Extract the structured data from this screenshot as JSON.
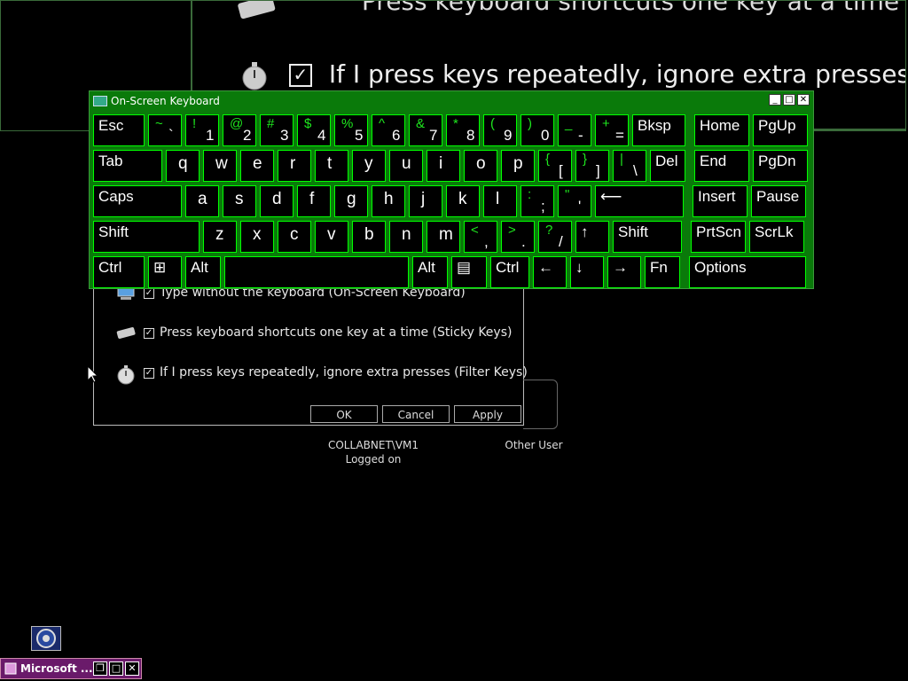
{
  "magnifier": {
    "line_top": "Press keyboard shortcuts one key at a time (Sticky Keys)",
    "line2": "If I press keys repeatedly, ignore extra presses (Filter Keys)"
  },
  "dialog": {
    "option1": "Type without the keyboard (On-Screen Keyboard)",
    "option2": "Press keyboard shortcuts one key at a time (Sticky Keys)",
    "option3": "If I press keys repeatedly, ignore extra presses (Filter Keys)",
    "ok": "OK",
    "cancel": "Cancel",
    "apply": "Apply"
  },
  "users": {
    "user1_name": "COLLABNET\\VM1",
    "user1_status": "Logged on",
    "user2_name": "Other User"
  },
  "osk": {
    "title": "On-Screen Keyboard",
    "rows": [
      [
        {
          "l": "Esc"
        },
        {
          "s": "~",
          "b": "`"
        },
        {
          "s": "!",
          "b": "1"
        },
        {
          "s": "@",
          "b": "2"
        },
        {
          "s": "#",
          "b": "3"
        },
        {
          "s": "$",
          "b": "4"
        },
        {
          "s": "%",
          "b": "5"
        },
        {
          "s": "^",
          "b": "6"
        },
        {
          "s": "&",
          "b": "7"
        },
        {
          "s": "*",
          "b": "8"
        },
        {
          "s": "(",
          "b": "9"
        },
        {
          "s": ")",
          "b": "0"
        },
        {
          "s": "_",
          "b": "-"
        },
        {
          "s": "+",
          "b": "="
        },
        {
          "l": "Bksp"
        },
        {
          "l": "Home"
        },
        {
          "l": "PgUp"
        }
      ],
      [
        {
          "l": "Tab"
        },
        {
          "c": "q"
        },
        {
          "c": "w"
        },
        {
          "c": "e"
        },
        {
          "c": "r"
        },
        {
          "c": "t"
        },
        {
          "c": "y"
        },
        {
          "c": "u"
        },
        {
          "c": "i"
        },
        {
          "c": "o"
        },
        {
          "c": "p"
        },
        {
          "s": "{",
          "b": "["
        },
        {
          "s": "}",
          "b": "]"
        },
        {
          "s": "|",
          "b": "\\"
        },
        {
          "l": "Del"
        },
        {
          "l": "End"
        },
        {
          "l": "PgDn"
        }
      ],
      [
        {
          "l": "Caps"
        },
        {
          "c": "a"
        },
        {
          "c": "s"
        },
        {
          "c": "d"
        },
        {
          "c": "f"
        },
        {
          "c": "g"
        },
        {
          "c": "h"
        },
        {
          "c": "j"
        },
        {
          "c": "k"
        },
        {
          "c": "l"
        },
        {
          "s": ":",
          "b": ";"
        },
        {
          "s": "\"",
          "b": "'"
        },
        {
          "l": "⟵"
        },
        {
          "l": "Insert"
        },
        {
          "l": "Pause"
        }
      ],
      [
        {
          "l": "Shift"
        },
        {
          "c": "z"
        },
        {
          "c": "x"
        },
        {
          "c": "c"
        },
        {
          "c": "v"
        },
        {
          "c": "b"
        },
        {
          "c": "n"
        },
        {
          "c": "m"
        },
        {
          "s": "<",
          "b": ","
        },
        {
          "s": ">",
          "b": "."
        },
        {
          "s": "?",
          "b": "/"
        },
        {
          "l": "↑"
        },
        {
          "l": "Shift"
        },
        {
          "l": "PrtScn"
        },
        {
          "l": "ScrLk"
        }
      ],
      [
        {
          "l": "Ctrl"
        },
        {
          "l": "⊞"
        },
        {
          "l": "Alt"
        },
        {
          "l": ""
        },
        {
          "l": "Alt"
        },
        {
          "l": "▤"
        },
        {
          "l": "Ctrl"
        },
        {
          "l": "←"
        },
        {
          "l": "↓"
        },
        {
          "l": "→"
        },
        {
          "l": "Fn"
        },
        {
          "l": "Options"
        }
      ]
    ]
  },
  "taskbar": {
    "task_label": "Microsoft ..."
  }
}
